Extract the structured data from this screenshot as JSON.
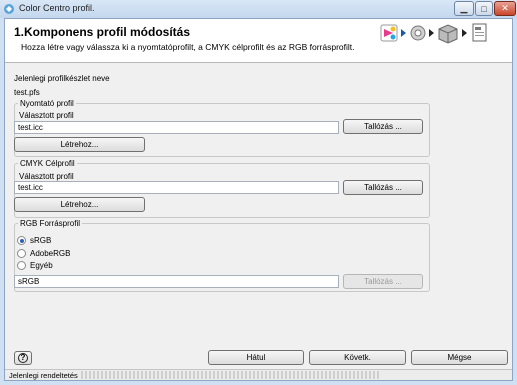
{
  "window": {
    "title": "Color Centro profil."
  },
  "header": {
    "title": "1.Komponens profil módosítás",
    "subtitle": "Hozza létre vagy válassza ki a nyomtatóprofilt, a CMYK célprofilt és az RGB forrásprofilt."
  },
  "current_set": {
    "label": "Jelenlegi profilkészlet neve",
    "value": "test.pfs"
  },
  "printer_profile": {
    "legend": "Nyomtató profil",
    "selected_label": "Választott profil",
    "value": "test.icc",
    "browse_label": "Tallózás ...",
    "create_label": "Létrehoz..."
  },
  "cmyk_profile": {
    "legend": "CMYK Célprofil",
    "selected_label": "Választott profil",
    "value": "test.icc",
    "browse_label": "Tallózás ...",
    "create_label": "Létrehoz..."
  },
  "rgb_profile": {
    "legend": "RGB Forrásprofil",
    "options": [
      "sRGB",
      "AdobeRGB",
      "Egyéb"
    ],
    "selected": "sRGB",
    "value": "sRGB",
    "browse_label": "Tallózás ..."
  },
  "footer": {
    "help_glyph": "?",
    "back_label": "Hátul",
    "next_label": "Követk.",
    "cancel_label": "Mégse"
  },
  "status": {
    "text": "Jelenlegi rendeltetés"
  },
  "icons": [
    "app-icon",
    "printer-step-icon",
    "gear-step-icon",
    "package-step-icon",
    "document-step-icon",
    "help-icon"
  ]
}
